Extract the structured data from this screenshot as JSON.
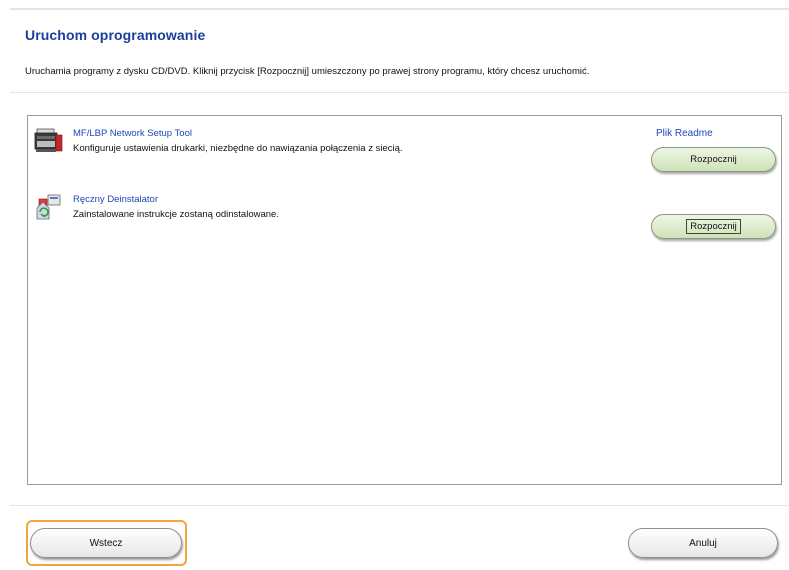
{
  "page": {
    "title": "Uruchom oprogramowanie",
    "description": "Uruchamia programy z dysku CD/DVD. Kliknij przycisk [Rozpocznij] umieszczony po prawej strony programu, który chcesz uruchomić."
  },
  "apps": [
    {
      "name": "MF/LBP Network Setup Tool",
      "description": "Konfiguruje ustawienia drukarki, niezbędne do nawiązania połączenia z siecią.",
      "icon": "printer-icon",
      "readme_label": "Plik Readme",
      "start_label": "Rozpocznij"
    },
    {
      "name": "Ręczny Deinstalator",
      "description": "Zainstalowane instrukcje zostaną odinstalowane.",
      "icon": "uninstaller-icon",
      "start_label": "Rozpocznij"
    }
  ],
  "footer": {
    "back_label": "Wstecz",
    "cancel_label": "Anuluj"
  },
  "colors": {
    "title": "#1b3f9c",
    "link": "#1f47b8",
    "start_button": "#cfe2b8",
    "focus_ring": "#f0a73a"
  }
}
